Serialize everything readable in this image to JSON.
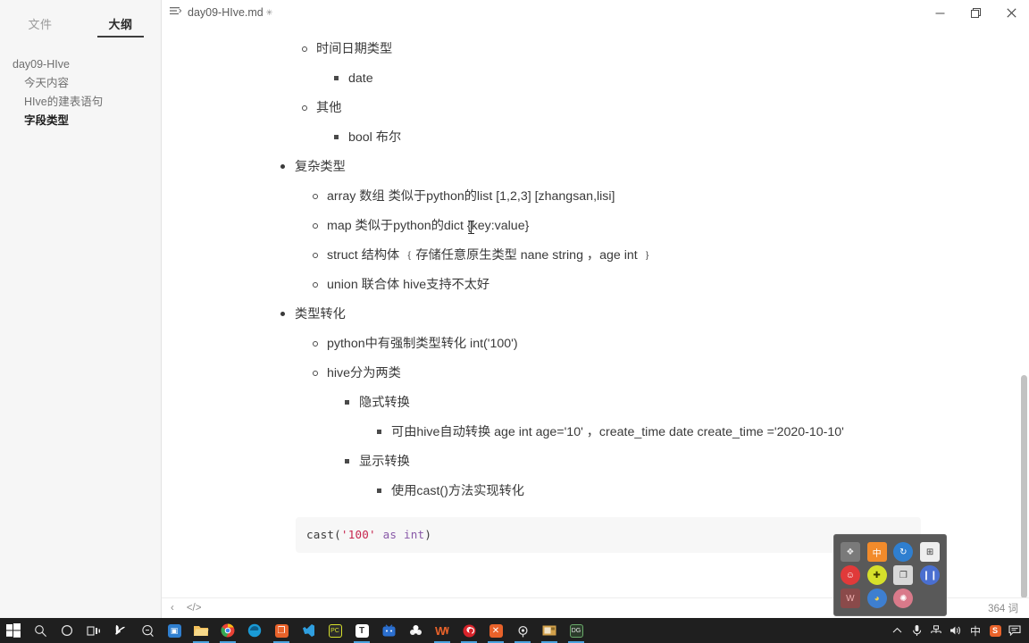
{
  "sidebar": {
    "tabs": [
      {
        "label": "文件",
        "name": "tab-files",
        "active": false
      },
      {
        "label": "大纲",
        "name": "tab-outline",
        "active": true
      }
    ],
    "outline": [
      {
        "label": "day09-HIve",
        "level": 1,
        "active": false
      },
      {
        "label": "今天内容",
        "level": 2,
        "active": false
      },
      {
        "label": "HIve的建表语句",
        "level": 2,
        "active": false
      },
      {
        "label": "字段类型",
        "level": 2,
        "active": true
      }
    ]
  },
  "titlebar": {
    "document_title": "day09-HIve.md",
    "modified_marker": "✳",
    "outline_icon": "outline-icon",
    "minimize_label": "—",
    "maximize_label": "❐",
    "close_label": "✕"
  },
  "document": {
    "nodes": [
      {
        "text": "时间日期类型",
        "bullet": "circle",
        "indent": 1
      },
      {
        "text": "date",
        "bullet": "square",
        "indent": 2
      },
      {
        "text": "其他",
        "bullet": "circle",
        "indent": 1
      },
      {
        "text": "bool 布尔",
        "bullet": "square",
        "indent": 2
      },
      {
        "text": "复杂类型",
        "bullet": "disc",
        "indent": 0
      },
      {
        "text": "array  数组 类似于python的list   [1,2,3]  [zhangsan,lisi]",
        "bullet": "circle",
        "indent": 1
      },
      {
        "text": "map   类似于python的dict  {key:value}",
        "bullet": "circle",
        "indent": 1
      },
      {
        "text": "struct  结构体 ﹛存储任意原生类型   nane  string ，age int  ﹜",
        "bullet": "circle",
        "indent": 1
      },
      {
        "text": "union  联合体   hive支持不太好",
        "bullet": "circle",
        "indent": 1
      },
      {
        "text": "类型转化",
        "bullet": "disc",
        "indent": 0
      },
      {
        "text": "python中有强制类型转化    int('100')",
        "bullet": "circle",
        "indent": 1
      },
      {
        "text": "hive分为两类",
        "bullet": "circle",
        "indent": 1
      },
      {
        "text": "隐式转换",
        "bullet": "square",
        "indent": 2
      },
      {
        "text": "可由hive自动转换   age  int    age='10' ，create_time  date      create_time ='2020-10-10'",
        "bullet": "square",
        "indent": 3
      },
      {
        "text": "显示转换",
        "bullet": "square",
        "indent": 2
      },
      {
        "text": "使用cast()方法实现转化",
        "bullet": "square",
        "indent": 3
      }
    ],
    "code_block": {
      "function": "cast(",
      "string": "'100'",
      "keyword": " as int",
      "closing": ")"
    }
  },
  "statusbar": {
    "back_icon": "‹",
    "source_code_icon": "</>",
    "word_count": "364 词"
  },
  "ime_panel": {
    "icons": [
      {
        "name": "ime-skin-icon",
        "glyph": "❖",
        "bg": "#7a7a7a",
        "fg": "#e8e8e8"
      },
      {
        "name": "ime-chinese-mode-icon",
        "glyph": "中",
        "bg": "#f28b2b",
        "fg": "#ffffff"
      },
      {
        "name": "ime-refresh-icon",
        "glyph": "↻",
        "bg": "#2f7fd0",
        "fg": "#ffffff"
      },
      {
        "name": "ime-keyboard-icon",
        "glyph": "⊞",
        "bg": "#eeeeee",
        "fg": "#3a3a3a"
      },
      {
        "name": "ime-emoji-icon",
        "glyph": "☺",
        "bg": "#e03a3a",
        "fg": "#ffffff"
      },
      {
        "name": "ime-plus-icon",
        "glyph": "✚",
        "bg": "#d6e02b",
        "fg": "#3a3a00"
      },
      {
        "name": "ime-clipboard-icon",
        "glyph": "❐",
        "bg": "#d8d8d8",
        "fg": "#4a4a4a"
      },
      {
        "name": "ime-pause-icon",
        "glyph": "❙❙",
        "bg": "#4a6fd0",
        "fg": "#ffffff"
      },
      {
        "name": "ime-w-icon",
        "glyph": "W",
        "bg": "#8a4a4a",
        "fg": "#f0b0b0"
      },
      {
        "name": "ime-palette-icon",
        "glyph": "◕",
        "bg": "#3e7fd0",
        "fg": "#f5d24a"
      },
      {
        "name": "ime-flower-icon",
        "glyph": "✺",
        "bg": "#d97a8a",
        "fg": "#ffffff"
      }
    ]
  },
  "taskbar": {
    "left_items": [
      {
        "name": "start-button",
        "glyph": "⊞",
        "fg": "#ffffff",
        "bg": "transparent",
        "running": false
      },
      {
        "name": "search-icon",
        "glyph": "◯",
        "fg": "#e6e6e6",
        "bg": "transparent",
        "running": false
      },
      {
        "name": "cortana-icon",
        "glyph": "◯",
        "fg": "#e6e6e6",
        "bg": "transparent",
        "running": false
      },
      {
        "name": "task-view-icon",
        "glyph": "❏",
        "fg": "#e6e6e6",
        "bg": "transparent",
        "running": false
      },
      {
        "name": "snipaste-icon",
        "glyph": "S",
        "fg": "#ffffff",
        "bg": "transparent",
        "running": false
      },
      {
        "name": "everything-search-icon",
        "glyph": "⌕",
        "fg": "#e6e6e6",
        "bg": "transparent",
        "running": false
      },
      {
        "name": "store-icon",
        "glyph": "▣",
        "fg": "#ffffff",
        "bg": "#2f7fd0",
        "running": false
      },
      {
        "name": "file-explorer-icon",
        "glyph": "▤",
        "fg": "#3a3a3a",
        "bg": "#f3b53d",
        "running": true
      },
      {
        "name": "chrome-icon",
        "glyph": "◉",
        "fg": "#ffffff",
        "bg": "#e94235",
        "running": true
      },
      {
        "name": "edge-icon",
        "glyph": "◉",
        "fg": "#ffffff",
        "bg": "#1a9bd7",
        "running": false
      },
      {
        "name": "typora-app-icon",
        "glyph": "❐",
        "fg": "#ffffff",
        "bg": "#e8622a",
        "running": true
      },
      {
        "name": "vscode-icon",
        "glyph": "◅",
        "fg": "#2f9fe0",
        "bg": "transparent",
        "running": false
      },
      {
        "name": "pycharm-icon",
        "glyph": "PC",
        "fg": "#d6e02b",
        "bg": "#2b2b2b",
        "running": false
      },
      {
        "name": "typora-icon",
        "glyph": "T",
        "fg": "#2b2b2b",
        "bg": "#ffffff",
        "running": true
      },
      {
        "name": "bilibili-icon",
        "glyph": "♠",
        "fg": "#ffffff",
        "bg": "#2b6fd0",
        "running": false
      },
      {
        "name": "clover-icon",
        "glyph": "✽",
        "fg": "#ffffff",
        "bg": "transparent",
        "running": false
      },
      {
        "name": "wps-icon",
        "glyph": "W",
        "fg": "#e8622a",
        "bg": "transparent",
        "running": true
      },
      {
        "name": "netease-music-icon",
        "glyph": "♪",
        "fg": "#ffffff",
        "bg": "#d8232a",
        "running": true
      },
      {
        "name": "xmind-icon",
        "glyph": "✕",
        "fg": "#ffffff",
        "bg": "#e8622a",
        "running": true
      },
      {
        "name": "navicat-icon",
        "glyph": "◎",
        "fg": "#e6e6e6",
        "bg": "transparent",
        "running": true
      },
      {
        "name": "image-viewer-icon",
        "glyph": "▦",
        "fg": "#3a3a3a",
        "bg": "#d2a04a",
        "running": true
      },
      {
        "name": "datagrip-icon",
        "glyph": "DG",
        "fg": "#e6e6e6",
        "bg": "#2b3b2b",
        "running": true
      }
    ],
    "tray_items": [
      {
        "name": "show-hidden-icons",
        "glyph": "⌃"
      },
      {
        "name": "microphone-icon",
        "glyph": "🎤"
      },
      {
        "name": "network-icon",
        "glyph": "🖧"
      },
      {
        "name": "volume-icon",
        "glyph": "🔊"
      },
      {
        "name": "ime-language-indicator",
        "glyph": "中"
      },
      {
        "name": "sogou-ime-icon",
        "glyph": "S"
      },
      {
        "name": "action-center-icon",
        "glyph": "🗨"
      }
    ]
  }
}
